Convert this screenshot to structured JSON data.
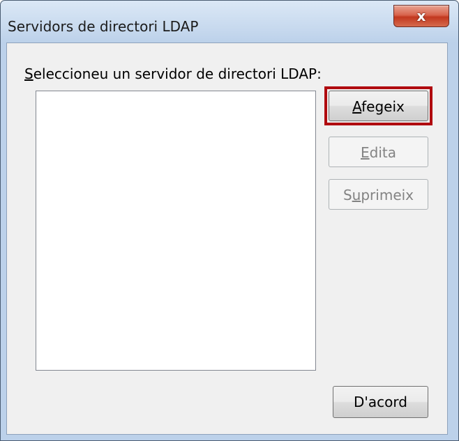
{
  "window": {
    "title": "Servidors de directori LDAP",
    "close_glyph": "x"
  },
  "dialog": {
    "prompt_label": "Seleccioneu un servidor de directori LDAP:",
    "servers": []
  },
  "buttons": {
    "add": "Afegeix",
    "edit": "Edita",
    "delete": "Suprimeix",
    "ok": "D'acord"
  },
  "colors": {
    "highlight": "#b00b0f",
    "client_bg": "#f0f0f0",
    "title_bg": "#c7d9ee"
  }
}
